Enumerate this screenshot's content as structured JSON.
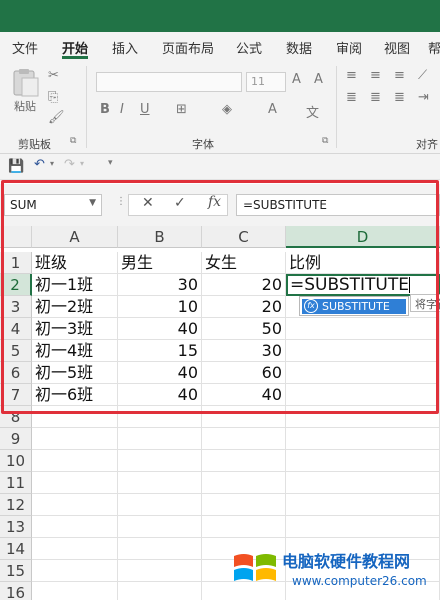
{
  "ribbon": {
    "tabs": [
      "文件",
      "开始",
      "插入",
      "页面布局",
      "公式",
      "数据",
      "审阅",
      "视图",
      "帮"
    ],
    "active_tab": "开始",
    "paste_label": "粘贴",
    "font_size": "11",
    "groups": [
      "剪贴板",
      "字体",
      "对齐"
    ]
  },
  "formula_bar": {
    "name_box": "SUM",
    "cancel": "✕",
    "enter": "✓",
    "fx": "fx",
    "content": "=SUBSTITUTE"
  },
  "sheet": {
    "columns": [
      "A",
      "B",
      "C",
      "D"
    ],
    "rows": [
      "1",
      "2",
      "3",
      "4",
      "5",
      "6",
      "7",
      "8",
      "9",
      "10",
      "11",
      "12",
      "13",
      "14",
      "15",
      "16"
    ],
    "header": [
      "班级",
      "男生",
      "女生",
      "比例"
    ],
    "data": [
      [
        "初一1班",
        "30",
        "20"
      ],
      [
        "初一2班",
        "10",
        "20"
      ],
      [
        "初一3班",
        "40",
        "50"
      ],
      [
        "初一4班",
        "15",
        "30"
      ],
      [
        "初一5班",
        "40",
        "60"
      ],
      [
        "初一6班",
        "40",
        "40"
      ]
    ],
    "active_cell_text": "=SUBSTITUTE",
    "selected_column": "D",
    "selected_row": "2"
  },
  "autocomplete": {
    "item": "SUBSTITUTE",
    "tooltip": "将字符"
  },
  "watermark": {
    "title": "电脑软硬件教程网",
    "url": "www.computer26.com"
  },
  "colors": {
    "excel_green": "#217346",
    "highlight_red": "#e0303a",
    "autocomplete_blue": "#2f7fd6"
  }
}
